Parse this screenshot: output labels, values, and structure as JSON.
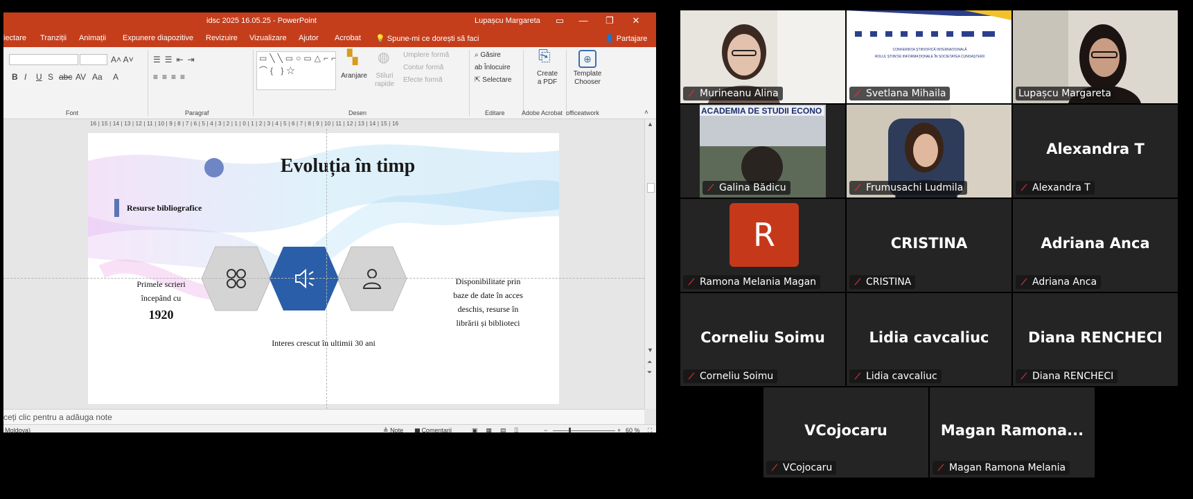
{
  "ppt": {
    "title": "idsc 2025 16.05.25  -  PowerPoint",
    "user": "Lupașcu Margareta",
    "tabs": [
      "iectare",
      "Tranziții",
      "Animații",
      "Expunere diapozitive",
      "Revizuire",
      "Vizualizare",
      "Ajutor",
      "Acrobat",
      "Spune-mi ce dorești să faci",
      "Partajare"
    ],
    "ribbon": {
      "groups": [
        "Font",
        "Paragraf",
        "Desen",
        "Editare",
        "Adobe Acrobat",
        "officeatwork"
      ],
      "aranjare": "Aranjare",
      "stiluri1": "Stiluri",
      "stiluri2": "rapide",
      "umplere": "Umplere formă",
      "contur": "Contur formă",
      "efecte": "Efecte formă",
      "gasire": "Găsire",
      "inlocuire": "Înlocuire",
      "selectare": "Selectare",
      "create1": "Create",
      "create2": "a PDF",
      "template1": "Template",
      "template2": "Chooser"
    },
    "ruler_text": "16 | 15 | 14 | 13 | 12 | 11 | 10 | 9 | 8 | 7 | 6 | 5 | 4 | 3 | 2 | 1 | 0 | 1 | 2 | 3 | 4 | 5 | 6 | 7 | 8 | 9 | 10 | 11 | 12 | 13 | 14 | 15 | 16",
    "slide": {
      "title": "Evoluția în timp",
      "section_label": "Resurse bibliografice",
      "left_text_1": "Primele scrieri",
      "left_text_2": "începând cu",
      "left_year": "1920",
      "right_text_1": "Disponibilitate prin",
      "right_text_2": "baze de date în acces",
      "right_text_3": "deschis, resurse în",
      "right_text_4": "librării și biblioteci",
      "bottom_text": "Interes crescut în ultimii 30 ani"
    },
    "notes_placeholder": "ceți clic pentru a adăuga note",
    "status": {
      "language": "Moldova)",
      "notes": "Note",
      "comments": "Comentarii",
      "zoom": "60 %"
    }
  },
  "poster": {
    "line1": "CONFERINȚA ȘTIINȚIFICĂ INTERNAȚIONALĂ",
    "line2": "ROLUL ȘTIINȚEI INFORMAȚIONALE ÎN SOCIETATEA CUNOAȘTERII",
    "academia": "ACADEMIA DE STUDII ECONO"
  },
  "participants": [
    {
      "name": "Murineanu Alina"
    },
    {
      "name": "Svetlana Mihaila"
    },
    {
      "name": "Lupașcu Margareta"
    },
    {
      "name": "Galina Bădicu"
    },
    {
      "name": "Frumusachi Ludmila"
    },
    {
      "name": "Alexandra T",
      "display": "Alexandra T"
    },
    {
      "name": "Ramona Melania Magan",
      "avatar": "R"
    },
    {
      "name": "CRISTINA",
      "display": "CRISTINA"
    },
    {
      "name": "Adriana Anca",
      "display": "Adriana Anca"
    },
    {
      "name": "Corneliu Soimu",
      "display": "Corneliu Soimu"
    },
    {
      "name": "Lidia cavcaliuc",
      "display": "Lidia cavcaliuc"
    },
    {
      "name": "Diana RENCHECI",
      "display": "Diana RENCHECI"
    },
    {
      "name": "VCojocaru",
      "display": "VCojocaru"
    },
    {
      "name": "Magan Ramona Melania",
      "display": "Magan  Ramona..."
    }
  ],
  "colors": {
    "ppt_accent": "#c43e1c",
    "active_speaker": "#3fd48a",
    "muted_mic": "#e2303a",
    "hex_blue": "#2a5ea8",
    "hex_gray": "#d4d4d4"
  }
}
